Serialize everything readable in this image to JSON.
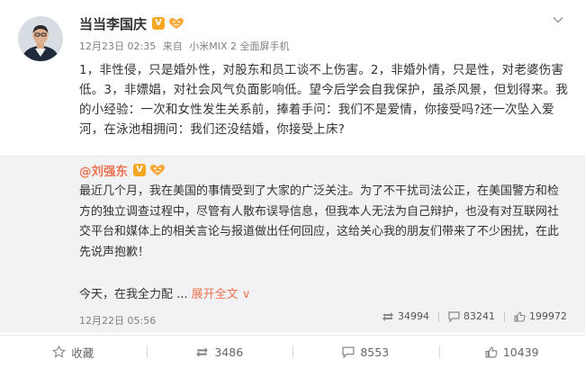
{
  "post": {
    "author": "当当李国庆",
    "badge_letter": "V",
    "date": "12月23日 02:35",
    "source_prefix": "来自",
    "source": "小米MIX 2 全面屏手机",
    "text": "1，非性侵，只是婚外性，对股东和员工谈不上伤害。2，非婚外情，只是性，对老婆伤害低。3，非嫖娼，对社会风气负面影响低。望今后学会自我保护，虽杀风景，但划得来。我的小经验：一次和女性发生关系前，捧着手问：我们不是爱情，你接受吗?还一次坠入爱河，在泳池相拥问：我们还没结婚，你接受上床?"
  },
  "repost": {
    "author": "@刘强东",
    "badge_letter": "V",
    "text": "最近几个月，我在美国的事情受到了大家的广泛关注。为了不干扰司法公正，在美国警方和检方的独立调查过程中，尽管有人散布误导信息，但我本人无法为自己辩护，也没有对互联网社交平台和媒体上的相关言论与报道做出任何回应，这给关心我的朋友们带来了不少困扰，在此先说声抱歉！",
    "text2": "今天，在我全力配 ...",
    "expand_label": "展开全文",
    "expand_arrow": "∨",
    "date": "12月22日 05:56",
    "reposts": "34994",
    "comments": "83241",
    "likes": "199972"
  },
  "actions": {
    "favorite": "收藏",
    "repost": "3486",
    "comment": "8553",
    "like": "10439"
  },
  "colors": {
    "accent": "#eb7350",
    "badge": "#f5a623",
    "repost_bg": "#f2f2f5"
  },
  "icons": [
    "chevron-down-icon",
    "verified-badge-icon",
    "fan-badge-icon",
    "repost-icon",
    "comment-icon",
    "like-icon",
    "star-icon"
  ]
}
